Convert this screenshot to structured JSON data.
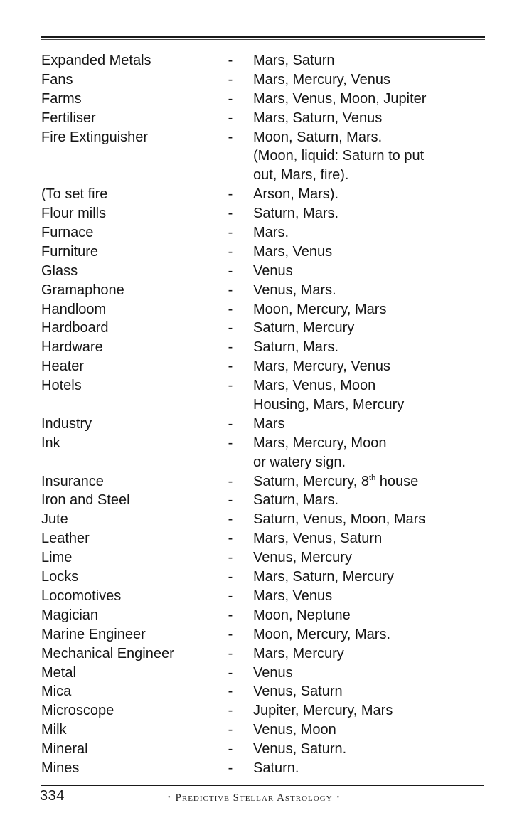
{
  "entries": [
    {
      "term": "Expanded Metals",
      "desc": [
        "Mars, Saturn"
      ]
    },
    {
      "term": "Fans",
      "desc": [
        "Mars, Mercury, Venus"
      ]
    },
    {
      "term": "Farms",
      "desc": [
        "Mars, Venus, Moon, Jupiter"
      ]
    },
    {
      "term": "Fertiliser",
      "desc": [
        "Mars, Saturn, Venus"
      ]
    },
    {
      "term": "Fire Extinguisher",
      "desc": [
        "Moon, Saturn, Mars.",
        "(Moon, liquid: Saturn to put",
        "out, Mars, fire)."
      ]
    },
    {
      "term": "(To set fire",
      "desc": [
        "Arson, Mars)."
      ]
    },
    {
      "term": "Flour mills",
      "desc": [
        "Saturn, Mars."
      ]
    },
    {
      "term": "Furnace",
      "desc": [
        "Mars."
      ]
    },
    {
      "term": "Furniture",
      "desc": [
        "Mars, Venus"
      ]
    },
    {
      "term": "Glass",
      "desc": [
        "Venus"
      ]
    },
    {
      "term": "Gramaphone",
      "desc": [
        "Venus, Mars."
      ]
    },
    {
      "term": "Handloom",
      "desc": [
        "Moon, Mercury, Mars"
      ]
    },
    {
      "term": "Hardboard",
      "desc": [
        "Saturn, Mercury"
      ]
    },
    {
      "term": "Hardware",
      "desc": [
        "Saturn, Mars."
      ]
    },
    {
      "term": "Heater",
      "desc": [
        "Mars, Mercury, Venus"
      ]
    },
    {
      "term": "Hotels",
      "desc": [
        "Mars, Venus, Moon",
        "Housing, Mars, Mercury"
      ]
    },
    {
      "term": "Industry",
      "desc": [
        "Mars"
      ]
    },
    {
      "term": "Ink",
      "desc": [
        "Mars, Mercury, Moon",
        "or watery sign."
      ]
    },
    {
      "term": "Insurance",
      "desc": [
        "Saturn, Mercury, 8",
        "th",
        " house"
      ]
    },
    {
      "term": "Iron and Steel",
      "desc": [
        "Saturn, Mars."
      ]
    },
    {
      "term": "Jute",
      "desc": [
        "Saturn, Venus, Moon, Mars"
      ]
    },
    {
      "term": "Leather",
      "desc": [
        "Mars, Venus, Saturn"
      ]
    },
    {
      "term": "Lime",
      "desc": [
        "Venus, Mercury"
      ]
    },
    {
      "term": "Locks",
      "desc": [
        "Mars, Saturn, Mercury"
      ]
    },
    {
      "term": "Locomotives",
      "desc": [
        "Mars, Venus"
      ]
    },
    {
      "term": "Magician",
      "desc": [
        "Moon, Neptune"
      ]
    },
    {
      "term": "Marine Engineer",
      "desc": [
        "Moon, Mercury, Mars."
      ]
    },
    {
      "term": "Mechanical Engineer",
      "desc": [
        "Mars, Mercury"
      ]
    },
    {
      "term": "Metal",
      "desc": [
        "Venus"
      ]
    },
    {
      "term": "Mica",
      "desc": [
        "Venus, Saturn"
      ]
    },
    {
      "term": "Microscope",
      "desc": [
        "Jupiter, Mercury, Mars"
      ]
    },
    {
      "term": "Milk",
      "desc": [
        "Venus, Moon"
      ]
    },
    {
      "term": "Mineral",
      "desc": [
        "Venus, Saturn."
      ]
    },
    {
      "term": "Mines",
      "desc": [
        "Saturn."
      ]
    }
  ],
  "separator": "-",
  "footer": {
    "page_number": "334",
    "running_title": "Predictive Stellar Astrology",
    "ornament": "•"
  }
}
